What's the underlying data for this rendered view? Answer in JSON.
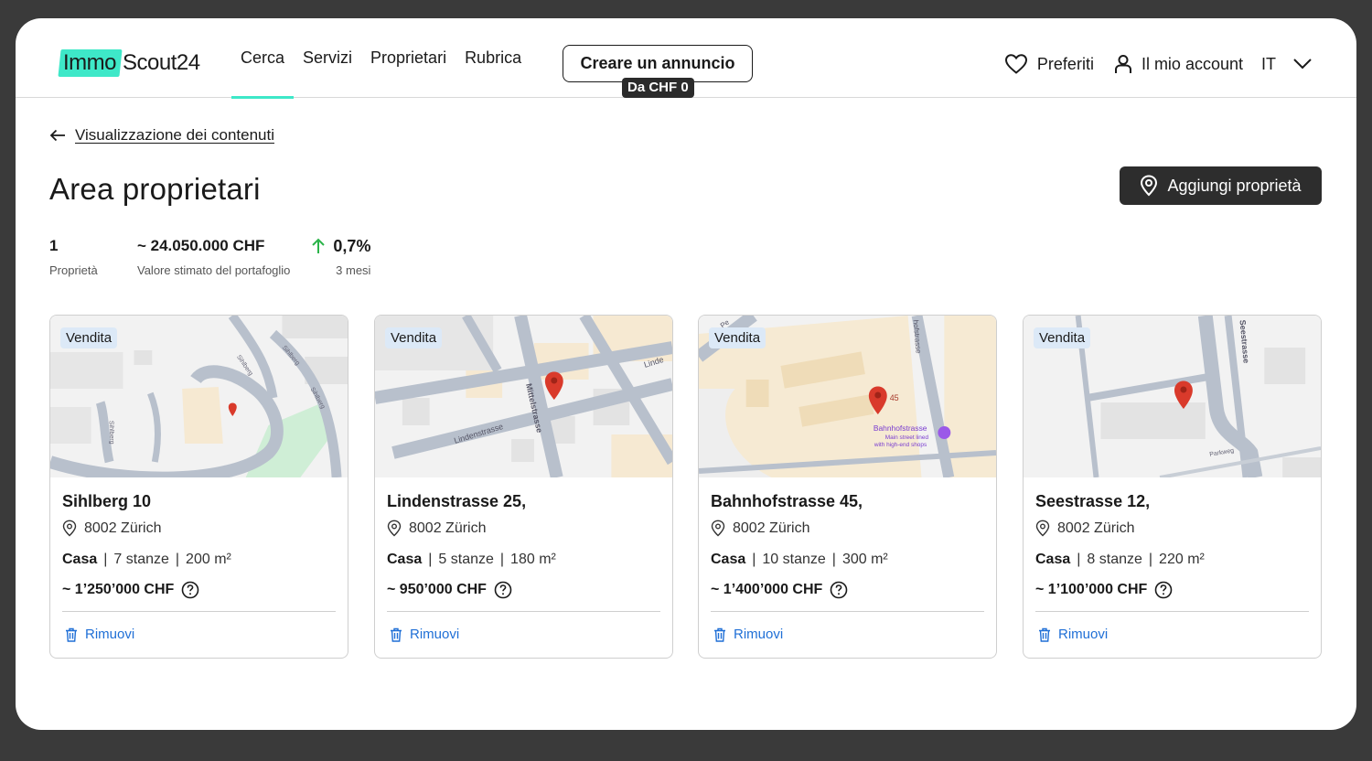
{
  "header": {
    "logo_part1": "Immo",
    "logo_part2": "Scout24",
    "nav": [
      {
        "label": "Cerca",
        "active": true
      },
      {
        "label": "Servizi",
        "active": false
      },
      {
        "label": "Proprietari",
        "active": false
      },
      {
        "label": "Rubrica",
        "active": false
      }
    ],
    "create_label": "Creare un annuncio",
    "create_badge": "Da CHF 0",
    "favorites_label": "Preferiti",
    "account_label": "Il mio account",
    "language": "IT"
  },
  "page": {
    "back_label": "Visualizzazione dei contenuti",
    "title": "Area proprietari",
    "add_label": "Aggiungi proprietà"
  },
  "stats": [
    {
      "value": "1",
      "label": "Proprietà"
    },
    {
      "value": "~ 24.050.000 CHF",
      "label": "Valore stimato del portafoglio"
    },
    {
      "value": "0,7%",
      "label": "3 mesi",
      "trend": "up"
    }
  ],
  "cards": [
    {
      "badge": "Vendita",
      "title": "Sihlberg 10",
      "location": "8002 Zürich",
      "type": "Casa",
      "rooms": "7 stanze",
      "area": "200 m²",
      "price": "~ 1’250’000 CHF",
      "remove": "Rimuovi",
      "map_labels": [
        "Sihlberg",
        "Sihlberg",
        "Sihlberg",
        "Sihlberg"
      ]
    },
    {
      "badge": "Vendita",
      "title": "Lindenstrasse 25,",
      "location": "8002 Zürich",
      "type": "Casa",
      "rooms": "5 stanze",
      "area": "180 m²",
      "price": "~ 950’000 CHF",
      "remove": "Rimuovi",
      "map_labels": [
        "Lindenstrasse",
        "Mittelstrasse",
        "Linde"
      ]
    },
    {
      "badge": "Vendita",
      "title": "Bahnhofstrasse 45,",
      "location": "8002 Zürich",
      "type": "Casa",
      "rooms": "10 stanze",
      "area": "300 m²",
      "price": "~ 1’400’000 CHF",
      "remove": "Rimuovi",
      "map_labels": [
        "45",
        "Bahnhofstrasse",
        "Main street lined",
        "with high-end shops",
        "hofstrasse",
        "Pe"
      ]
    },
    {
      "badge": "Vendita",
      "title": "Seestrasse 12,",
      "location": "8002 Zürich",
      "type": "Casa",
      "rooms": "8 stanze",
      "area": "220 m²",
      "price": "~ 1’100’000 CHF",
      "remove": "Rimuovi",
      "map_labels": [
        "Seestrasse",
        "Parkweg"
      ]
    }
  ],
  "colors": {
    "accent": "#3ee8c8",
    "link": "#1f6fd6",
    "pin": "#d93a2b",
    "trend_up": "#2bb44a"
  }
}
